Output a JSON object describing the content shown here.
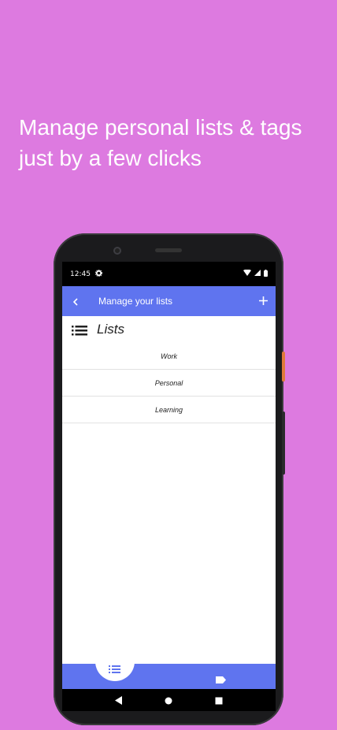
{
  "headline": {
    "line1": "Manage personal lists & tags",
    "line2": "just by a few clicks"
  },
  "status_bar": {
    "time": "12:45"
  },
  "app_bar": {
    "title": "Manage your lists",
    "back_icon": "chevron-left-icon",
    "add_icon": "plus-icon"
  },
  "section": {
    "title": "Lists",
    "icon": "menu-list-icon"
  },
  "lists": [
    {
      "label": "Work"
    },
    {
      "label": "Personal"
    },
    {
      "label": "Learning"
    }
  ],
  "bottom_nav": {
    "left_icon": "list-icon",
    "right_icon": "tag-icon"
  },
  "colors": {
    "background": "#dd7ae0",
    "primary": "#5f74ef"
  }
}
